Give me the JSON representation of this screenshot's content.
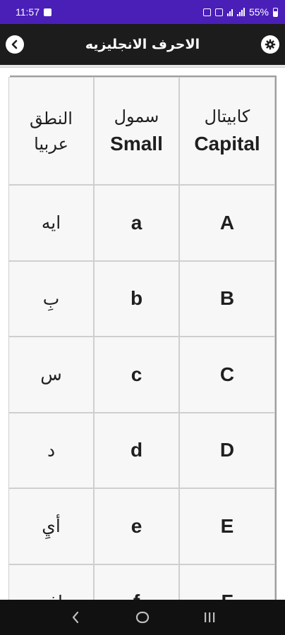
{
  "status_bar": {
    "time": "11:57",
    "battery": "55%",
    "icons": [
      "message-icon",
      "alarm-icon",
      "mute-icon",
      "wifi-icon",
      "signal-icon",
      "battery-icon"
    ]
  },
  "app_bar": {
    "title": "الاحرف الانجليزيه",
    "back_icon": "chevron-left-icon",
    "settings_icon": "gear-icon",
    "background": "#1c1c1c"
  },
  "table": {
    "headers": {
      "capital_ar": "كابيتال",
      "capital_en": "Capital",
      "small_ar": "سمول",
      "small_en": "Small",
      "pron_ar_1": "النطق",
      "pron_ar_2": "عربيا"
    },
    "rows": [
      {
        "capital": "A",
        "small": "a",
        "pronunciation": "ايه"
      },
      {
        "capital": "B",
        "small": "b",
        "pronunciation": "بِ"
      },
      {
        "capital": "C",
        "small": "c",
        "pronunciation": "س"
      },
      {
        "capital": "D",
        "small": "d",
        "pronunciation": "د"
      },
      {
        "capital": "E",
        "small": "e",
        "pronunciation": "أيِ"
      },
      {
        "capital": "F",
        "small": "f",
        "pronunciation": "إف"
      }
    ]
  },
  "nav_bar": {
    "buttons": [
      "back-nav-icon",
      "home-nav-icon",
      "recents-nav-icon"
    ]
  },
  "colors": {
    "status_bar": "#4a1fb8",
    "app_bar": "#1c1c1c",
    "cell_bg": "#f7f7f7",
    "grid_border": "#9e9e9e"
  }
}
